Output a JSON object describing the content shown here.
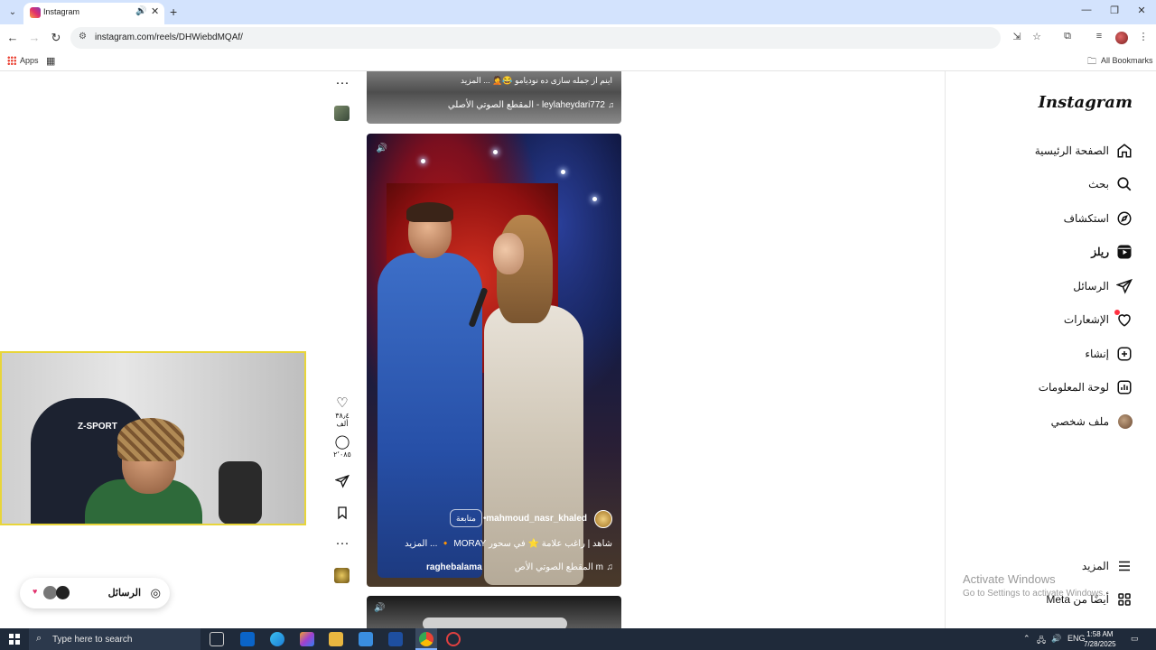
{
  "browser": {
    "tab_title": "Instagram",
    "url": "instagram.com/reels/DHWiebdMQAf/",
    "bookmarks": {
      "apps": "Apps",
      "all_bookmarks": "All Bookmarks"
    }
  },
  "sidebar": {
    "logo": "Instagram",
    "items": [
      {
        "label": "الصفحة الرئيسية",
        "icon": "home-icon"
      },
      {
        "label": "بحث",
        "icon": "search-icon"
      },
      {
        "label": "استكشاف",
        "icon": "compass-icon"
      },
      {
        "label": "ريلز",
        "icon": "reels-icon",
        "active": true
      },
      {
        "label": "الرسائل",
        "icon": "send-icon"
      },
      {
        "label": "الإشعارات",
        "icon": "heart-icon"
      },
      {
        "label": "إنشاء",
        "icon": "plus-icon"
      },
      {
        "label": "لوحة المعلومات",
        "icon": "dashboard-icon"
      },
      {
        "label": "ملف شخصي",
        "icon": "avatar-icon"
      }
    ],
    "more": "المزيد",
    "also_from_meta": "أيضًا من Meta"
  },
  "feed": {
    "prev_reel": {
      "caption": "اینم از جمله سازی ده نودیامو 😂🤦 ... المزيد",
      "audio": "leylaheydari772 - المقطع الصوتي الأصلي"
    },
    "reel": {
      "username": "mahmoud_nasr_khaled",
      "follow": "متابعة",
      "caption": "شاهد | راغب علامة ⭐ في سحور MORAY 🔸 ... المزيد",
      "audio": "m المقطع الصوتي الأص",
      "collab": "raghebalama",
      "likes": "٣٨٫٤ ألف",
      "comments": "٢٬٠٨٥"
    }
  },
  "messages_pill": {
    "label": "الرسائل"
  },
  "watermark": {
    "line1": "Activate Windows",
    "line2": "Go to Settings to activate Windows."
  },
  "webcam": {
    "chair_brand": "Z-SPORT"
  },
  "taskbar": {
    "search_placeholder": "Type here to search",
    "lang": "ENG",
    "time": "1:58 AM",
    "date": "7/28/2025"
  }
}
